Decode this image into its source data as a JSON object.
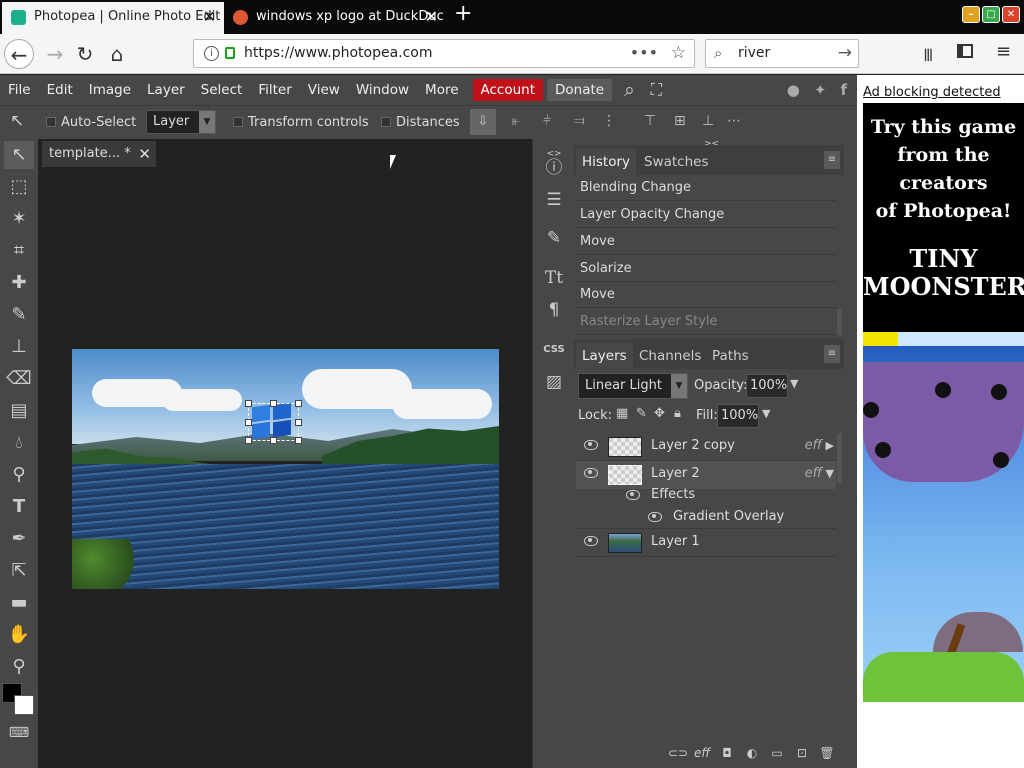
{
  "browser": {
    "tabs": [
      {
        "title": "Photopea | Online Photo Edit",
        "active": true,
        "favicon_color": "#1eb08a"
      },
      {
        "title": "windows xp logo at DuckDuc",
        "active": false,
        "favicon_color": "#de5833"
      }
    ],
    "url": "https://www.photopea.com",
    "search_query": "river",
    "window_controls": [
      "minimize",
      "maximize",
      "close"
    ]
  },
  "photopea": {
    "menu": [
      "File",
      "Edit",
      "Image",
      "Layer",
      "Select",
      "Filter",
      "View",
      "Window",
      "More"
    ],
    "account_label": "Account",
    "donate_label": "Donate",
    "social_icons": [
      "reddit-icon",
      "twitter-icon",
      "facebook-icon"
    ],
    "options": {
      "auto_select_label": "Auto-Select",
      "auto_select_mode": "Layer",
      "transform_controls_label": "Transform controls",
      "distances_label": "Distances"
    },
    "document_tab": "template.⁠.. *",
    "history": {
      "tab_label": "History",
      "swatches_label": "Swatches",
      "items": [
        "Blending Change",
        "Layer Opacity Change",
        "Move",
        "Solarize",
        "Move",
        "Rasterize Layer Style"
      ]
    },
    "layers_panel": {
      "tabs": [
        "Layers",
        "Channels",
        "Paths"
      ],
      "blend_mode": "Linear Light",
      "opacity_label": "Opacity:",
      "opacity": "100%",
      "lock_label": "Lock:",
      "fill_label": "Fill:",
      "fill": "100%",
      "layers": [
        {
          "name": "Layer 2 copy",
          "fx": "eff"
        },
        {
          "name": "Layer 2",
          "fx": "eff"
        },
        {
          "name": "Effects",
          "fx": ""
        },
        {
          "name": "Gradient Overlay",
          "fx": ""
        },
        {
          "name": "Layer 1",
          "fx": ""
        }
      ]
    }
  },
  "ad": {
    "blocking_text": "Ad blocking detected",
    "promo_lines": [
      "Try this game",
      "from the",
      "creators",
      "of Photopea!"
    ],
    "game_title_line1": "TINY",
    "game_title_line2": "MOONSTERS"
  }
}
